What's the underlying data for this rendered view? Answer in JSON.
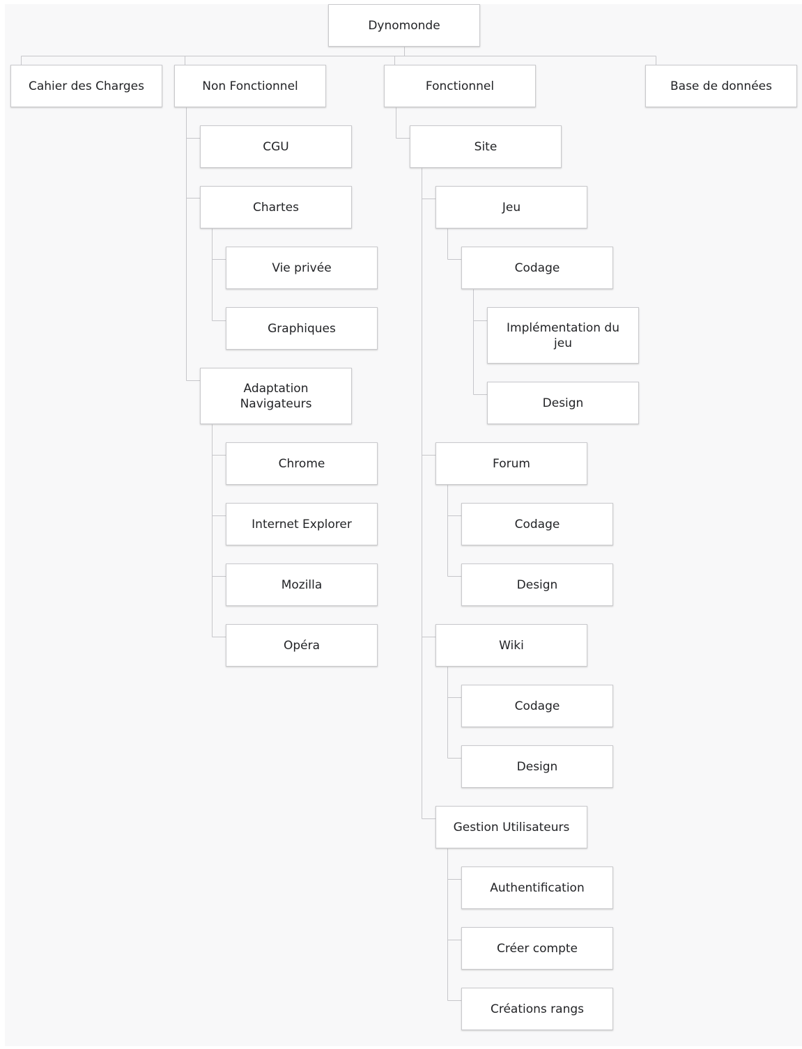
{
  "diagram": {
    "root": "Dynomonde",
    "nodes": {
      "cahier": "Cahier des Charges",
      "nonfonc": "Non Fonctionnel",
      "fonc": "Fonctionnel",
      "bdd": "Base de données",
      "cgu": "CGU",
      "chartes": "Chartes",
      "vie": "Vie privée",
      "graph": "Graphiques",
      "adapt": "Adaptation Navigateurs",
      "chrome": "Chrome",
      "ie": "Internet Explorer",
      "mozilla": "Mozilla",
      "opera": "Opéra",
      "site": "Site",
      "jeu": "Jeu",
      "jeu_codage": "Codage",
      "impl": "Implémentation du jeu",
      "jeu_design": "Design",
      "forum": "Forum",
      "forum_codage": "Codage",
      "forum_design": "Design",
      "wiki": "Wiki",
      "wiki_codage": "Codage",
      "wiki_design": "Design",
      "gestion": "Gestion Utilisateurs",
      "auth": "Authentification",
      "creer": "Créer compte",
      "rangs": "Créations rangs"
    }
  },
  "colors": {
    "box_border": "#c9c9cc",
    "connector": "#c6c6ca",
    "background": "#f8f8f9",
    "text": "#222326"
  }
}
